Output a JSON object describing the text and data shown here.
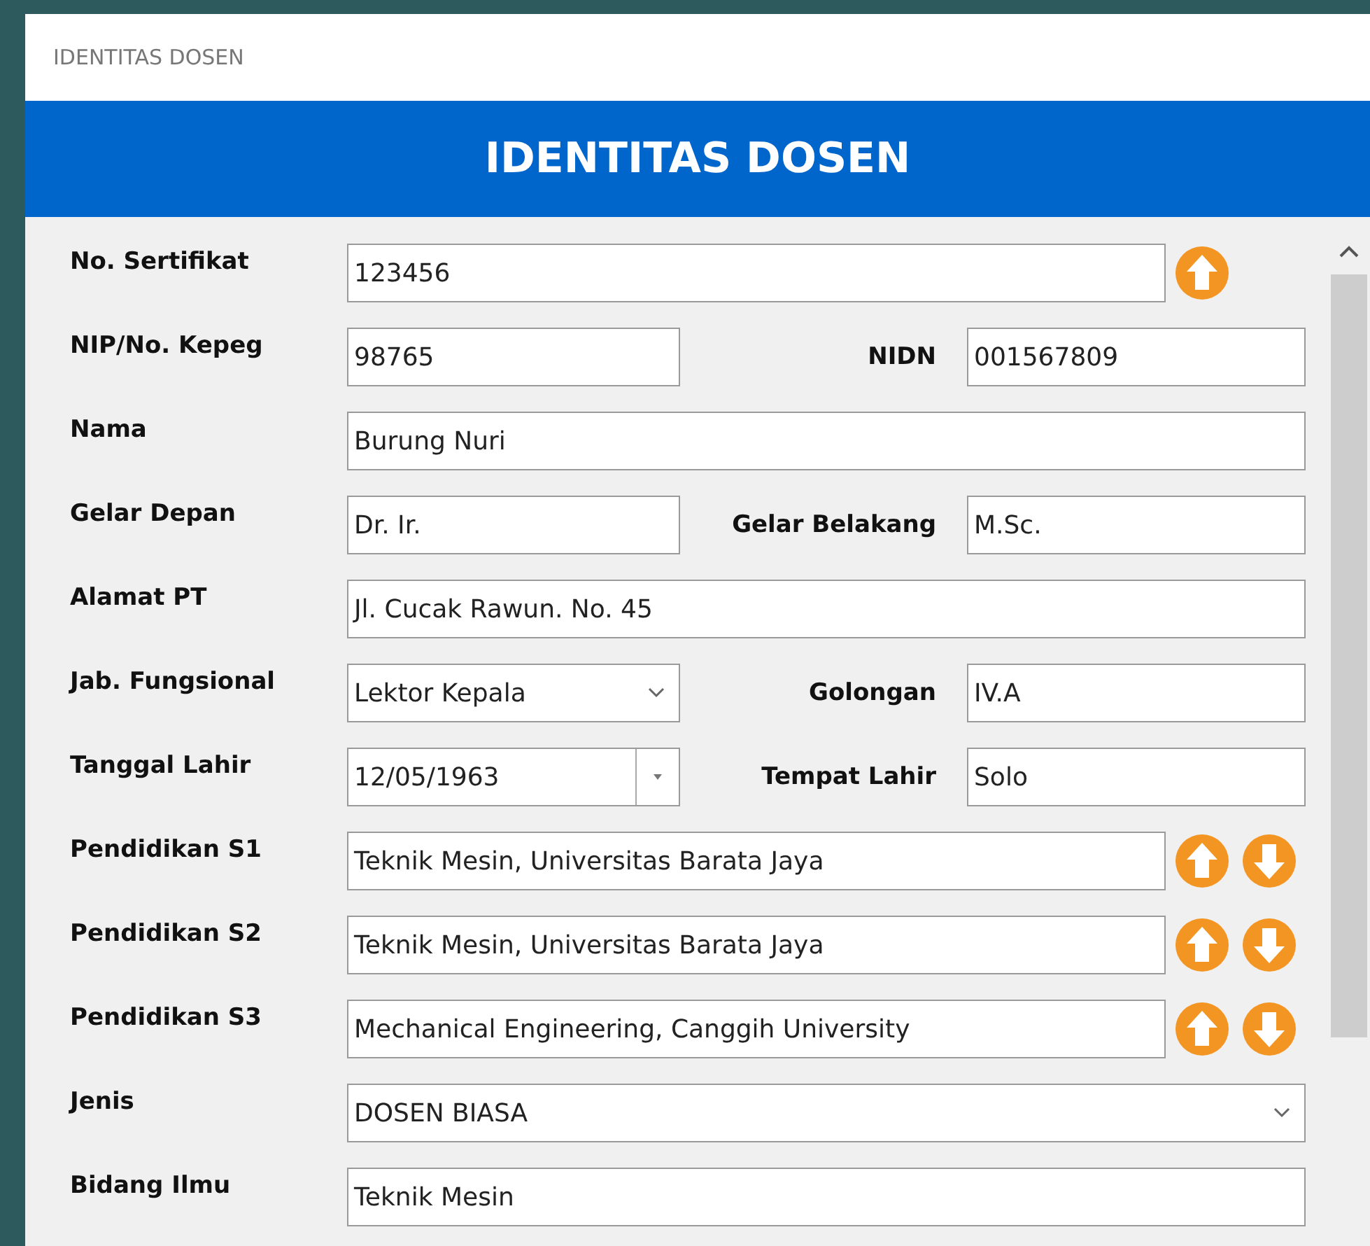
{
  "window": {
    "title": "IDENTITAS DOSEN"
  },
  "header": {
    "title": "IDENTITAS DOSEN"
  },
  "rows": [
    {
      "up_button": true,
      "down_button": false,
      "fields": [
        {
          "label": "No. Sertifikat",
          "value": "123456",
          "kind": "text"
        }
      ]
    },
    {
      "up_button": false,
      "down_button": false,
      "fields": [
        {
          "label": "NIP/No. Kepeg",
          "value": "98765",
          "kind": "text"
        },
        {
          "label": "NIDN",
          "value": "001567809",
          "kind": "text"
        }
      ]
    },
    {
      "up_button": false,
      "down_button": false,
      "fields": [
        {
          "label": "Nama",
          "value": "Burung Nuri",
          "kind": "text"
        }
      ]
    },
    {
      "up_button": false,
      "down_button": false,
      "fields": [
        {
          "label": "Gelar Depan",
          "value": "Dr. Ir.",
          "kind": "text"
        },
        {
          "label": "Gelar Belakang",
          "value": "M.Sc.",
          "kind": "text"
        }
      ]
    },
    {
      "up_button": false,
      "down_button": false,
      "fields": [
        {
          "label": "Alamat PT",
          "value": "Jl. Cucak Rawun. No. 45",
          "kind": "text"
        }
      ]
    },
    {
      "up_button": false,
      "down_button": false,
      "fields": [
        {
          "label": "Jab. Fungsional",
          "value": "Lektor Kepala",
          "kind": "dropdown"
        },
        {
          "label": "Golongan",
          "value": "IV.A",
          "kind": "text"
        }
      ]
    },
    {
      "up_button": false,
      "down_button": false,
      "fields": [
        {
          "label": "Tanggal Lahir",
          "value": "12/05/1963",
          "kind": "date"
        },
        {
          "label": "Tempat Lahir",
          "value": "Solo",
          "kind": "text"
        }
      ]
    },
    {
      "up_button": true,
      "down_button": true,
      "fields": [
        {
          "label": "Pendidikan S1",
          "value": "Teknik Mesin, Universitas Barata Jaya",
          "kind": "text"
        }
      ]
    },
    {
      "up_button": true,
      "down_button": true,
      "fields": [
        {
          "label": "Pendidikan S2",
          "value": "Teknik Mesin, Universitas Barata Jaya",
          "kind": "text"
        }
      ]
    },
    {
      "up_button": true,
      "down_button": true,
      "fields": [
        {
          "label": "Pendidikan S3",
          "value": "Mechanical Engineering, Canggih University",
          "kind": "text"
        }
      ]
    },
    {
      "up_button": false,
      "down_button": false,
      "fields": [
        {
          "label": "Jenis",
          "value": "DOSEN BIASA",
          "kind": "dropdown"
        }
      ]
    },
    {
      "up_button": false,
      "down_button": false,
      "fields": [
        {
          "label": "Bidang Ilmu",
          "value": "Teknik Mesin",
          "kind": "text"
        }
      ]
    }
  ]
}
